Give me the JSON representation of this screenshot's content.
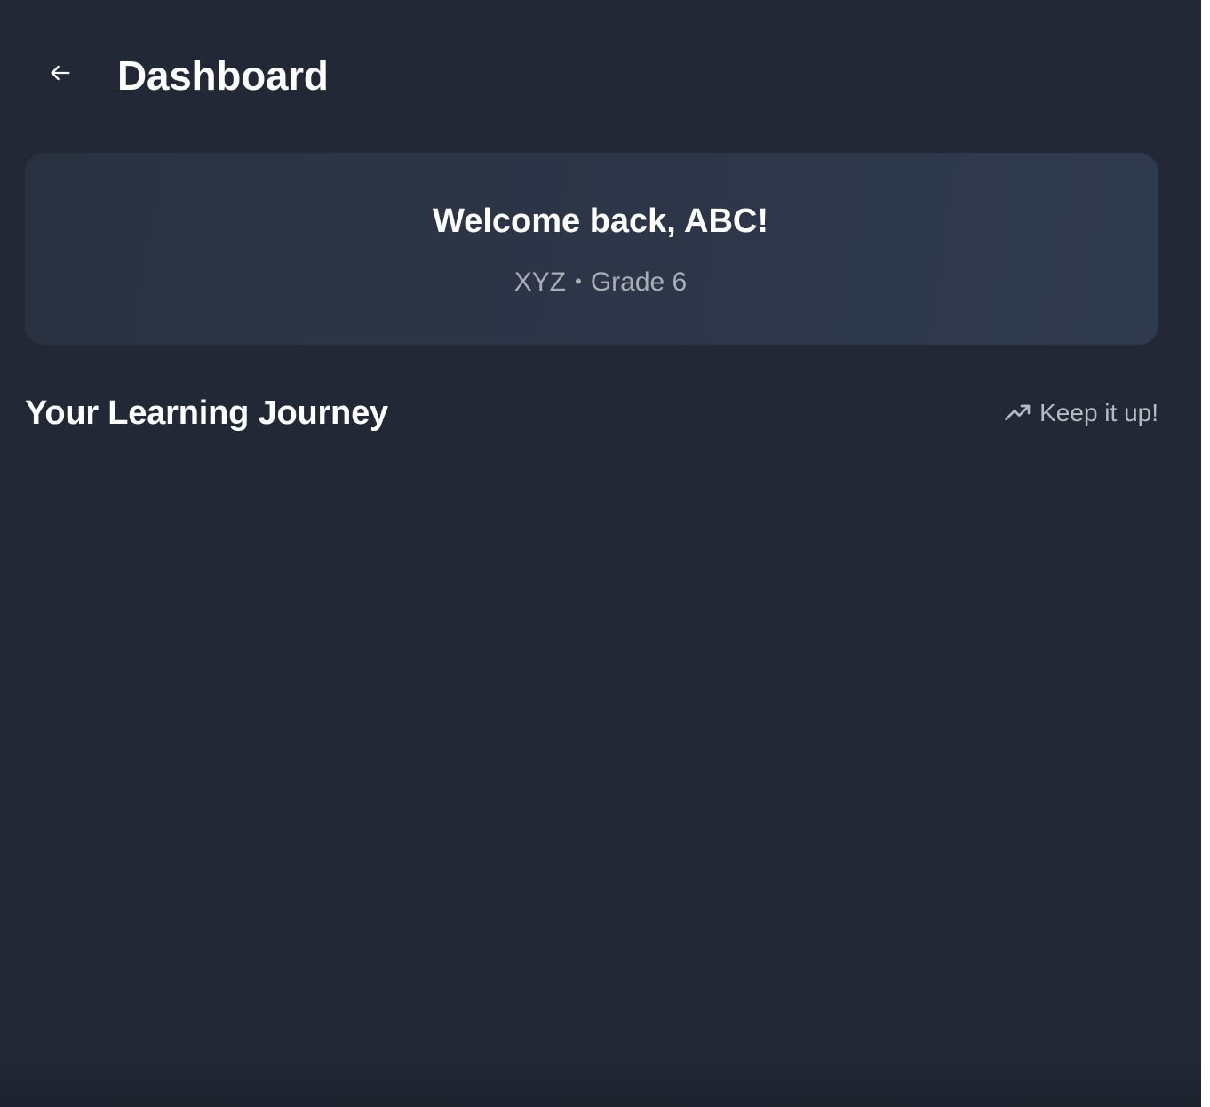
{
  "header": {
    "back_icon": "arrow-left-icon",
    "title": "Dashboard"
  },
  "welcome_card": {
    "greeting": "Welcome back, ABC!",
    "school": "XYZ",
    "separator": "•",
    "grade": "Grade 6"
  },
  "journey": {
    "title": "Your Learning Journey",
    "trend_icon": "trending-up-icon",
    "status": "Keep it up!"
  },
  "colors": {
    "background": "#222836",
    "card": "#2d3648",
    "text_primary": "#ffffff",
    "text_secondary": "#a8adb6"
  }
}
